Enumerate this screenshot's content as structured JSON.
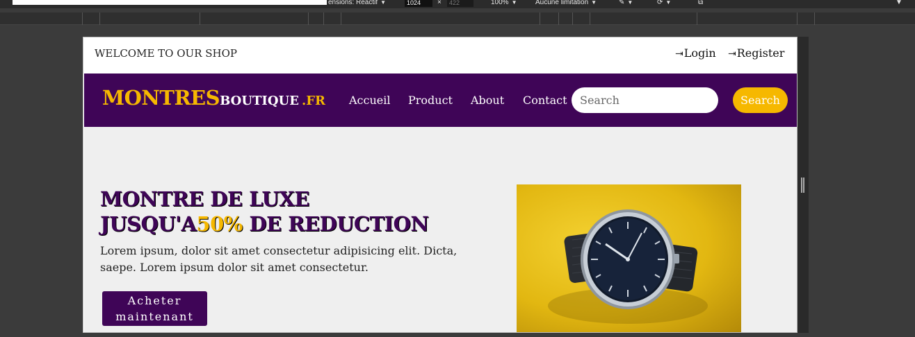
{
  "devtools": {
    "dimensions_label": "ensions: Réactif",
    "width_value": "1024",
    "times": "×",
    "height_value": "422",
    "zoom": "100%",
    "throttle": "Aucune limitation"
  },
  "topbar": {
    "welcome": "WELCOME TO OUR SHOP",
    "login": "Login",
    "register": "Register"
  },
  "nav": {
    "logo_main": "MONTRES",
    "logo_sub": "BOUTIQUE",
    "logo_domain": ".FR",
    "links": [
      "Accueil",
      "Product",
      "About",
      "Contact"
    ],
    "search_placeholder": "Search",
    "search_button": "Search"
  },
  "hero": {
    "title_line1": "MONTRE DE LUXE",
    "title_line2_before": "JUSQU'A",
    "title_accent": "50%",
    "title_line2_after": " DE REDUCTION",
    "description": "Lorem ipsum, dolor sit amet consectetur adipisicing elit. Dicta, saepe. Lorem ipsum dolor sit amet consectetur.",
    "buy_button": "Acheter maintenant"
  },
  "colors": {
    "brand_purple": "#3f0557",
    "accent_yellow": "#f6b800"
  }
}
